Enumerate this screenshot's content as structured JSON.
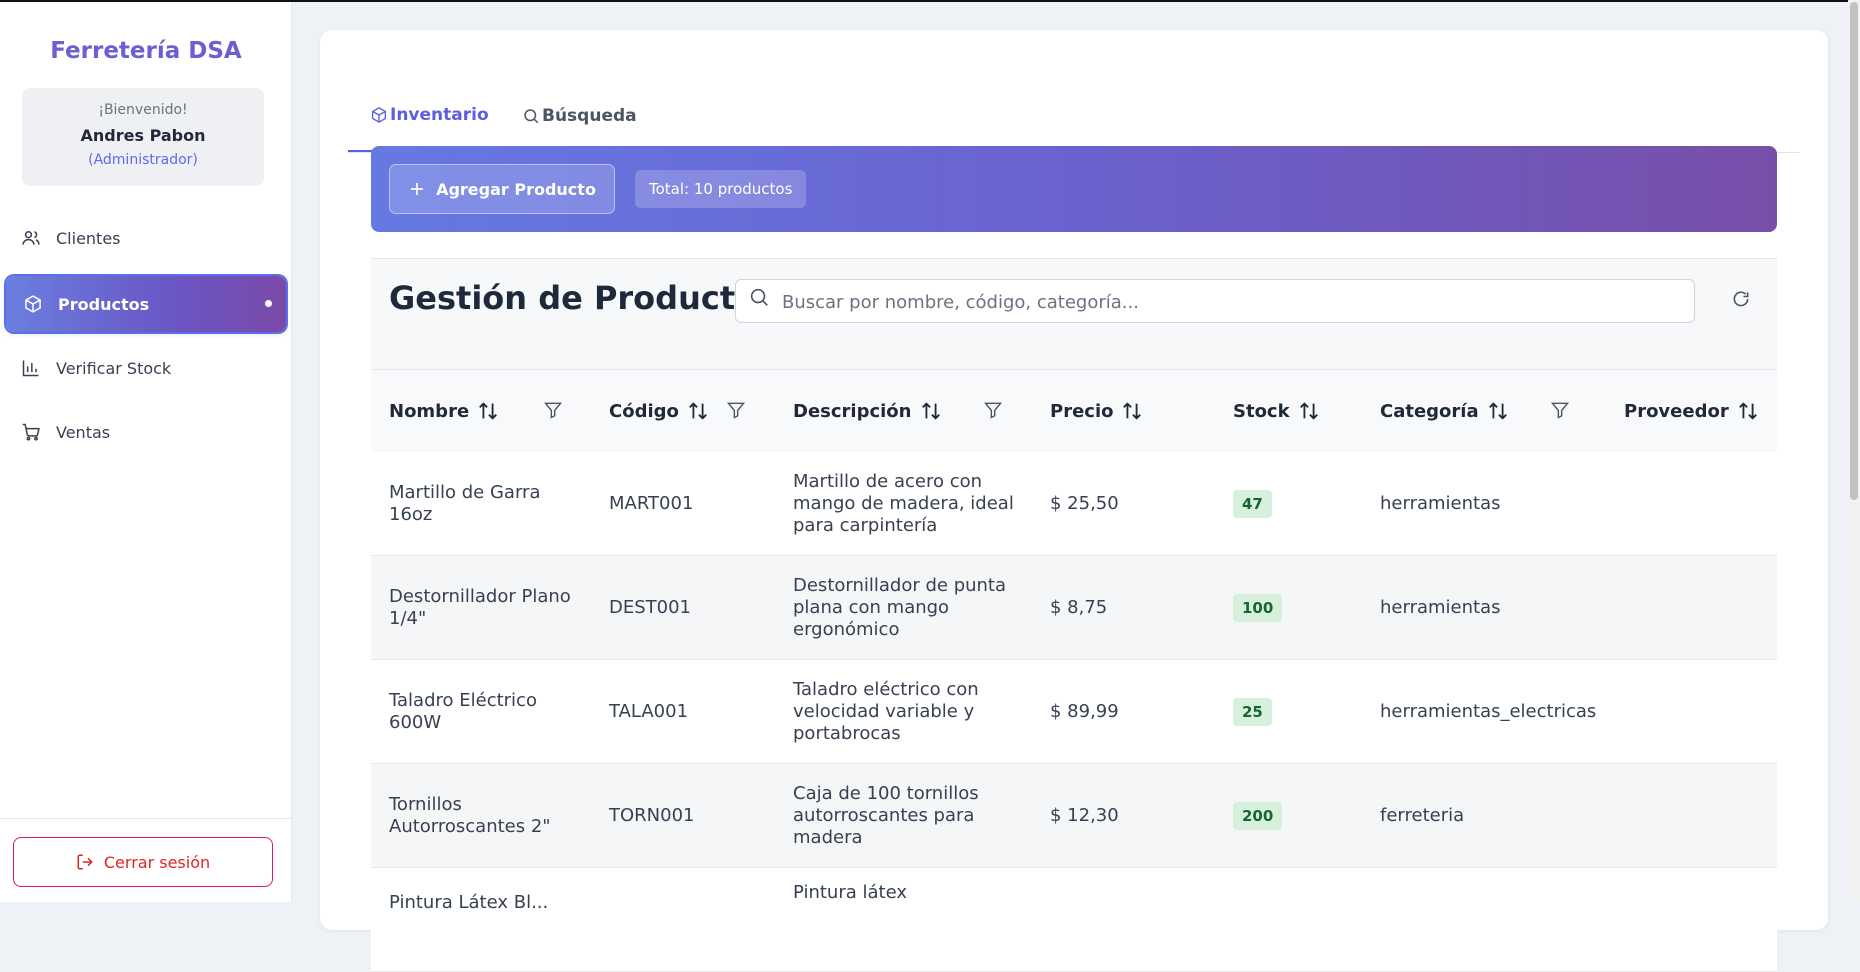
{
  "sidebar": {
    "brand": "Ferretería DSA",
    "welcome": {
      "greeting": "¡Bienvenido!",
      "name": "Andres Pabon",
      "role": "(Administrador)"
    },
    "nav": [
      {
        "label": "Clientes",
        "icon": "users-icon"
      },
      {
        "label": "Productos",
        "icon": "box-icon",
        "active": true
      },
      {
        "label": "Verificar Stock",
        "icon": "bar-chart-icon"
      },
      {
        "label": "Ventas",
        "icon": "cart-icon"
      }
    ],
    "logout_label": "Cerrar sesión"
  },
  "tabs": [
    {
      "label": "Inventario",
      "icon": "box-icon",
      "active": true
    },
    {
      "label": "Búsqueda",
      "icon": "search-icon"
    }
  ],
  "banner": {
    "add_label": "Agregar Producto",
    "total_label": "Total: 10 productos"
  },
  "table": {
    "title": "Gestión de Productos",
    "search_placeholder": "Buscar por nombre, código, categoría...",
    "columns": [
      "Nombre",
      "Código",
      "Descripción",
      "Precio",
      "Stock",
      "Categoría",
      "Proveedor"
    ],
    "rows": [
      {
        "nombre": "Martillo de Garra 16oz",
        "codigo": "MART001",
        "descripcion": "Martillo de acero con mango de madera, ideal para carpintería",
        "precio": "$ 25,50",
        "stock": "47",
        "categoria": "herramientas",
        "proveedor": ""
      },
      {
        "nombre": "Destornillador Plano 1/4\"",
        "codigo": "DEST001",
        "descripcion": "Destornillador de punta plana con mango ergonómico",
        "precio": "$ 8,75",
        "stock": "100",
        "categoria": "herramientas",
        "proveedor": ""
      },
      {
        "nombre": "Taladro Eléctrico 600W",
        "codigo": "TALA001",
        "descripcion": "Taladro eléctrico con velocidad variable y portabrocas",
        "precio": "$ 89,99",
        "stock": "25",
        "categoria": "herramientas_electricas",
        "proveedor": ""
      },
      {
        "nombre": "Tornillos Autorroscantes 2\"",
        "codigo": "TORN001",
        "descripcion": "Caja de 100 tornillos autorroscantes para madera",
        "precio": "$ 12,30",
        "stock": "200",
        "categoria": "ferreteria",
        "proveedor": ""
      },
      {
        "nombre": "Pintura Látex Bl...",
        "codigo": "",
        "descripcion": "Pintura látex",
        "precio": "",
        "stock": "",
        "categoria": "",
        "proveedor": ""
      }
    ]
  },
  "colors": {
    "accent": "#5b5fe0",
    "brand": "#6b5fd1",
    "danger": "#dc2626",
    "stock_bg": "#d6f0dc"
  }
}
